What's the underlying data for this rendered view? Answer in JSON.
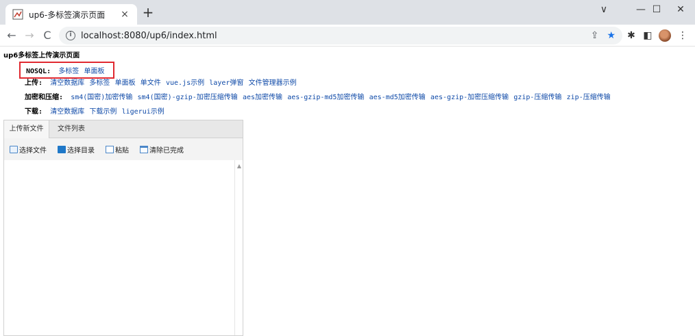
{
  "browser": {
    "tab_title": "up6-多标签演示页面",
    "tab_close": "×",
    "new_tab": "+",
    "minimize": "∨",
    "restore": "—",
    "maximize": "☐",
    "close": "✕",
    "back": "←",
    "forward": "→",
    "reload": "C",
    "url": "localhost:8080/up6/index.html",
    "info": "i",
    "share": "⇪",
    "star": "★",
    "extensions": "✱",
    "sidepanel": "◧",
    "menu": "⋮"
  },
  "page": {
    "title": "up6多标签上传演示页面",
    "nosql": {
      "label": "NOSQL:",
      "links": [
        "多标签",
        "单面板"
      ]
    },
    "upload": {
      "label": "上传:",
      "links": [
        "清空数据库",
        "多标签",
        "单面板",
        "单文件",
        "vue.js示例",
        "layer弹窗",
        "文件管理器示例"
      ]
    },
    "encrypt": {
      "label": "加密和压缩:",
      "links": [
        "sm4(国密)加密传输",
        "sm4(国密)-gzip-加密压缩传输",
        "aes加密传输",
        "aes-gzip-md5加密传输",
        "aes-md5加密传输",
        "aes-gzip-加密压缩传输",
        "gzip-压缩传输",
        "zip-压缩传输"
      ]
    },
    "download": {
      "label": "下载:",
      "links": [
        "清空数据库",
        "下载示例",
        "ligerui示例"
      ]
    }
  },
  "panel": {
    "tabs": [
      "上传新文件",
      "文件列表"
    ],
    "toolbar": [
      "选择文件",
      "选择目录",
      "粘贴",
      "清除已完成"
    ],
    "scroll_up": "▲"
  }
}
